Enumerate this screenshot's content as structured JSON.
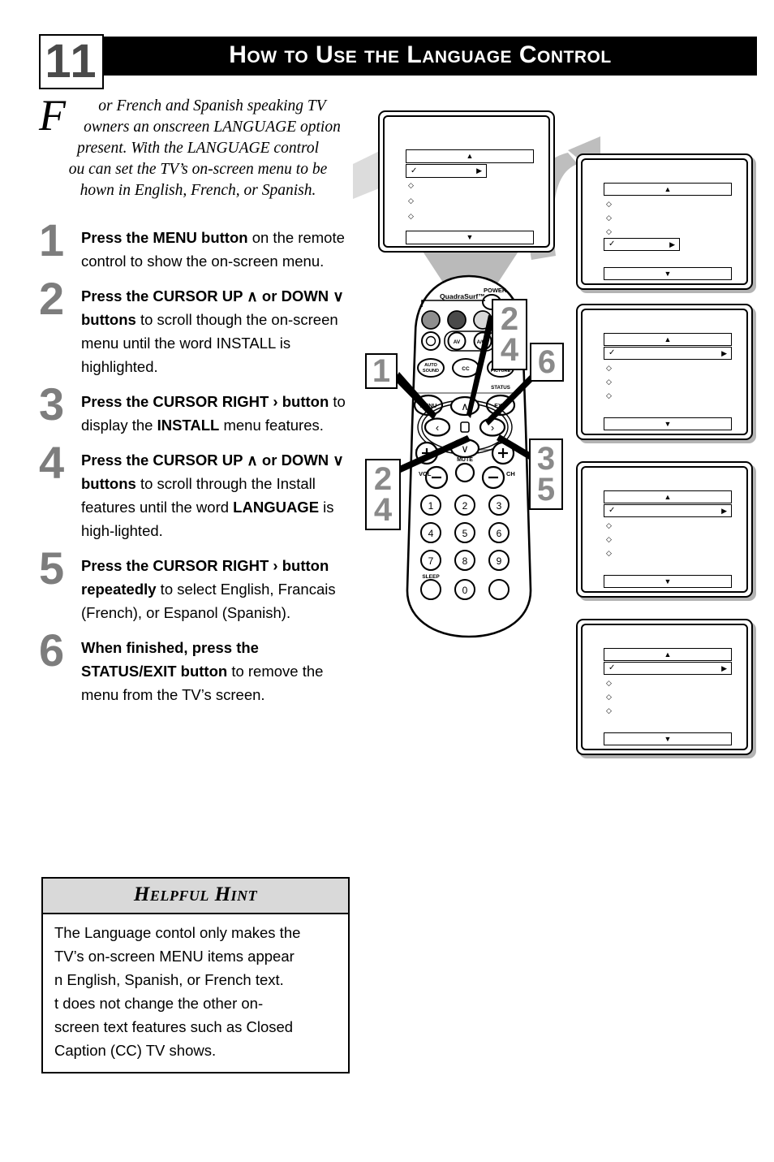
{
  "header": {
    "page_number": "11",
    "title": "How to Use the Language Control"
  },
  "intro": {
    "dropcap": "F",
    "lines": [
      "or French and Spanish speaking TV",
      "owners an onscreen LANGUAGE option",
      "present. With the LANGUAGE control",
      "ou can set the TV’s on-screen menu to be",
      "hown in English, French, or Spanish."
    ]
  },
  "steps": [
    {
      "number": "1",
      "html": "<b>Press the MENU button</b> on the remote control to show the on-screen menu."
    },
    {
      "number": "2",
      "html": "<b>Press the CURSOR UP ∧ or DOWN ∨ buttons</b> to scroll though the on-screen menu until the word INSTALL is highlighted."
    },
    {
      "number": "3",
      "html": "<b>Press the CURSOR RIGHT › button</b> to display the <b>INSTALL</b> menu features."
    },
    {
      "number": "4",
      "html": "<b>Press the CURSOR UP ∧ or DOWN ∨ buttons</b> to scroll through the Install features until the word <b>LANGUAGE</b> is high-lighted."
    },
    {
      "number": "5",
      "html": "<b>Press the CURSOR RIGHT › button repeatedly</b> to select English, Francais (French), or Espanol (Spanish)."
    },
    {
      "number": "6",
      "html": "<b>When finished, press the STATUS/EXIT button</b> to remove the menu from the TV’s screen."
    }
  ],
  "hint": {
    "title": "Helpful Hint",
    "lines": [
      "The Language contol only makes the",
      "TV’s on-screen MENU items appear",
      " n English, Spanish, or French text.",
      " t does not change the other on-",
      "screen text features such as Closed",
      "Caption (CC) TV shows."
    ]
  },
  "osd": {
    "up_arrow": "▲",
    "down_arrow": "▼",
    "right_arrow": "▶",
    "check": "✓",
    "diamond": "◇"
  },
  "tv": {
    "highlight_index": 1,
    "diamond_count": 3,
    "label": "tv-on-screen-menu"
  },
  "panels": [
    {
      "label": "install-menu-panel",
      "highlight_index": 4,
      "highlight_wide": false
    },
    {
      "label": "language-menu-panel-1",
      "highlight_index": 1,
      "highlight_wide": true
    },
    {
      "label": "language-menu-panel-2",
      "highlight_index": 1,
      "highlight_wide": true
    },
    {
      "label": "language-menu-panel-3",
      "highlight_index": 1,
      "highlight_wide": true
    }
  ],
  "remote": {
    "brand": "QuadraSurf™",
    "power_label": "POWER",
    "buttons": {
      "av": "AV",
      "ach": "A/CH",
      "auto_sound": "AUTO SOUND",
      "cc": "CC",
      "auto_picture": "AUTO PICTURE",
      "menu": "MENU",
      "status_exit_top": "STATUS",
      "status_exit_bottom": "EXIT",
      "mute": "MUTE",
      "vol": "VOL",
      "ch": "CH",
      "sleep": "SLEEP",
      "plus": "+",
      "minus": "–"
    },
    "keypad": [
      "1",
      "2",
      "3",
      "4",
      "5",
      "6",
      "7",
      "8",
      "9",
      "0"
    ],
    "cursor": {
      "up": "∧",
      "down": "∨",
      "left": "‹",
      "right": "›"
    }
  },
  "callouts": [
    {
      "name": "callout-1",
      "values": [
        "1"
      ]
    },
    {
      "name": "callout-2-4-top",
      "values": [
        "2",
        "4"
      ]
    },
    {
      "name": "callout-6",
      "values": [
        "6"
      ]
    },
    {
      "name": "callout-2-4-left",
      "values": [
        "2",
        "4"
      ]
    },
    {
      "name": "callout-3-5",
      "values": [
        "3",
        "5"
      ]
    }
  ],
  "colors": {
    "header_bg": "#000000",
    "step_number": "#7d7d7d",
    "hint_header_bg": "#d9d9d9",
    "connector_gray": "#b3b3b3"
  }
}
